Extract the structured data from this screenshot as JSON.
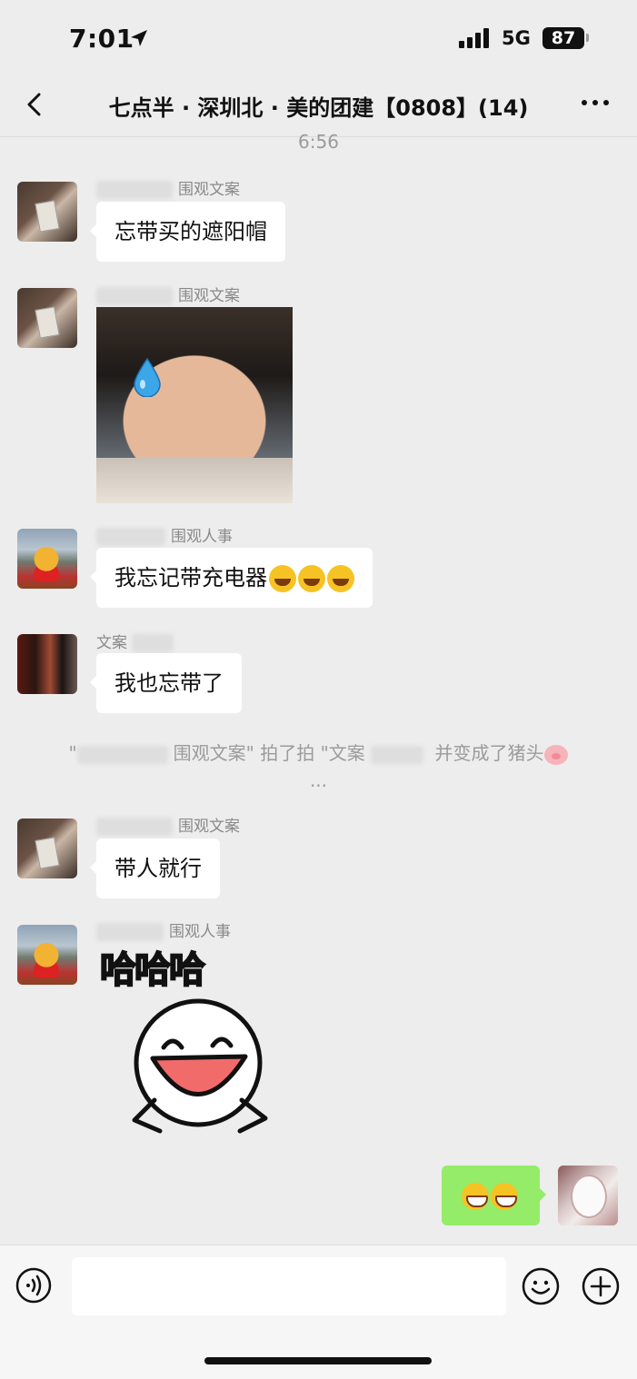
{
  "status_bar": {
    "time": "7:01",
    "network": "5G",
    "battery": "87"
  },
  "header": {
    "title": "七点半 · 深圳北 · 美的团建【0808】(14)"
  },
  "timestamp": "6:56",
  "messages": [
    {
      "sender": "围观文案",
      "text": "忘带买的遮阳帽"
    },
    {
      "sender": "围观文案"
    },
    {
      "sender": "围观人事",
      "text": "我忘记带充电器"
    },
    {
      "sender": "文案",
      "text": "我也忘带了"
    },
    {
      "sender": "围观文案",
      "text": "带人就行"
    },
    {
      "sender": "围观人事",
      "sticker_text": "哈哈哈"
    }
  ],
  "system_notice": {
    "part1": "\"",
    "part2": "围观文案\" 拍了拍 \"文案",
    "part3": "并变成了猪头",
    "more": "..."
  },
  "colors": {
    "self_bubble": "#95ec69",
    "background": "#ededed",
    "bubble": "#ffffff"
  },
  "icons": [
    "location-arrow-icon",
    "back-chevron-icon",
    "more-dots-icon",
    "water-drop-icon",
    "voice-icon",
    "emoji-icon",
    "plus-icon",
    "pig-face-icon",
    "laughing-crying-emoji-icon",
    "grinning-emoji-icon"
  ]
}
